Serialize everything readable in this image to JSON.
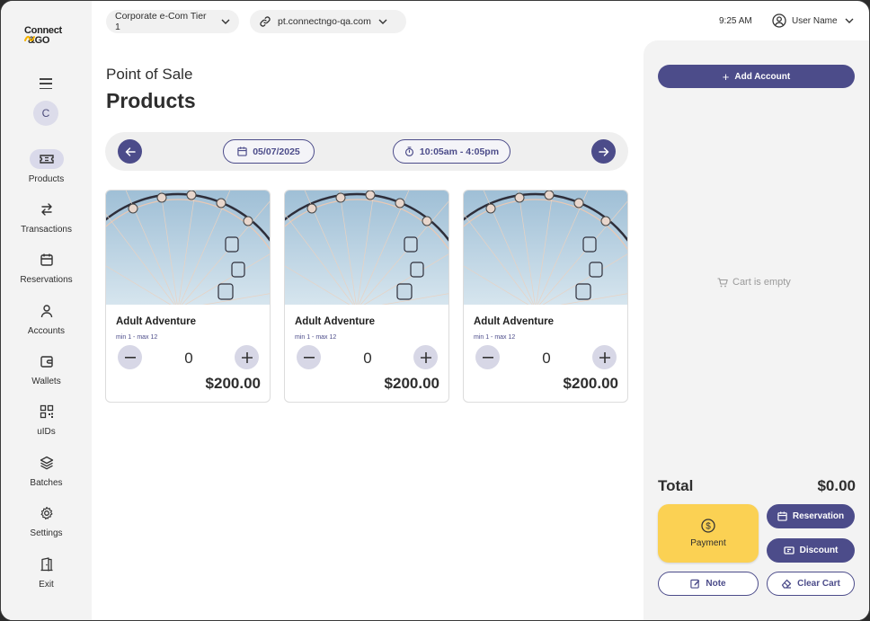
{
  "brand": {
    "line1": "Connect",
    "line2": "&GO"
  },
  "sidebar": {
    "avatar_initial": "C",
    "items": [
      {
        "label": "Products",
        "icon": "ticket-icon",
        "active": true
      },
      {
        "label": "Transactions",
        "icon": "swap-arrows-icon",
        "active": false
      },
      {
        "label": "Reservations",
        "icon": "calendar-icon",
        "active": false
      },
      {
        "label": "Accounts",
        "icon": "person-icon",
        "active": false
      },
      {
        "label": "Wallets",
        "icon": "wallet-icon",
        "active": false
      },
      {
        "label": "uIDs",
        "icon": "qr-code-icon",
        "active": false
      },
      {
        "label": "Batches",
        "icon": "layers-icon",
        "active": false
      },
      {
        "label": "Settings",
        "icon": "gear-icon",
        "active": false
      },
      {
        "label": "Exit",
        "icon": "door-exit-icon",
        "active": false
      }
    ]
  },
  "topbar": {
    "tier": "Corporate e-Com Tier 1",
    "domain": "pt.connectngo-qa.com",
    "time": "9:25 AM",
    "user": "User Name"
  },
  "main": {
    "subtitle": "Point of Sale",
    "title": "Products",
    "date": "05/07/2025",
    "time_range": "10:05am - 4:05pm",
    "products": [
      {
        "name": "Adult Adventure",
        "range": "min 1 - max 12",
        "qty": "0",
        "price": "$200.00"
      },
      {
        "name": "Adult Adventure",
        "range": "min 1 - max 12",
        "qty": "0",
        "price": "$200.00"
      },
      {
        "name": "Adult Adventure",
        "range": "min 1 - max 12",
        "qty": "0",
        "price": "$200.00"
      }
    ]
  },
  "cart": {
    "add_account": "Add Account",
    "empty_text": "Cart is empty",
    "total_label": "Total",
    "total_value": "$0.00",
    "payment": "Payment",
    "reservation": "Reservation",
    "discount": "Discount",
    "note": "Note",
    "clear_cart": "Clear Cart"
  },
  "colors": {
    "accent": "#4c4c8a",
    "payment": "#fbd153",
    "panel": "#f3f3f3"
  }
}
